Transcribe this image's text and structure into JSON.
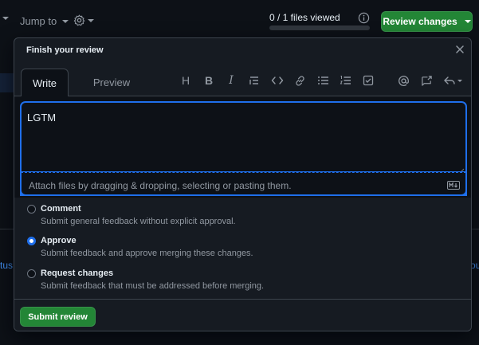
{
  "topbar": {
    "jump_to_label": "Jump to",
    "files_viewed_text": "0 / 1 files viewed",
    "files_viewed_progress": 0,
    "review_changes_label": "Review changes"
  },
  "background": {
    "left_link_fragment": "tus",
    "right_link_fragment": "ou"
  },
  "dialog": {
    "title": "Finish your review",
    "tabs": [
      {
        "label": "Write",
        "selected": true
      },
      {
        "label": "Preview",
        "selected": false
      }
    ],
    "toolbar_icons": [
      "heading-icon",
      "bold-icon",
      "italic-icon",
      "quote-icon",
      "code-icon",
      "link-icon",
      "unordered-list-icon",
      "ordered-list-icon",
      "task-list-icon",
      "mention-icon",
      "cross-reference-icon",
      "saved-replies-icon"
    ],
    "toolbar_glyphs": {
      "heading": "H",
      "bold": "B",
      "italic": "I"
    },
    "comment_value": "LGTM",
    "attach_hint": "Attach files by dragging & dropping, selecting or pasting them.",
    "options": [
      {
        "title": "Comment",
        "description": "Submit general feedback without explicit approval.",
        "checked": false
      },
      {
        "title": "Approve",
        "description": "Submit feedback and approve merging these changes.",
        "checked": true
      },
      {
        "title": "Request changes",
        "description": "Submit feedback that must be addressed before merging.",
        "checked": false
      }
    ],
    "submit_label": "Submit review"
  },
  "colors": {
    "background": "#0d1117",
    "dialog_bg": "#161b22",
    "accent_blue": "#1f6feb",
    "primary_green": "#238636",
    "muted_text": "#9198a1",
    "link_blue": "#4493f8"
  }
}
